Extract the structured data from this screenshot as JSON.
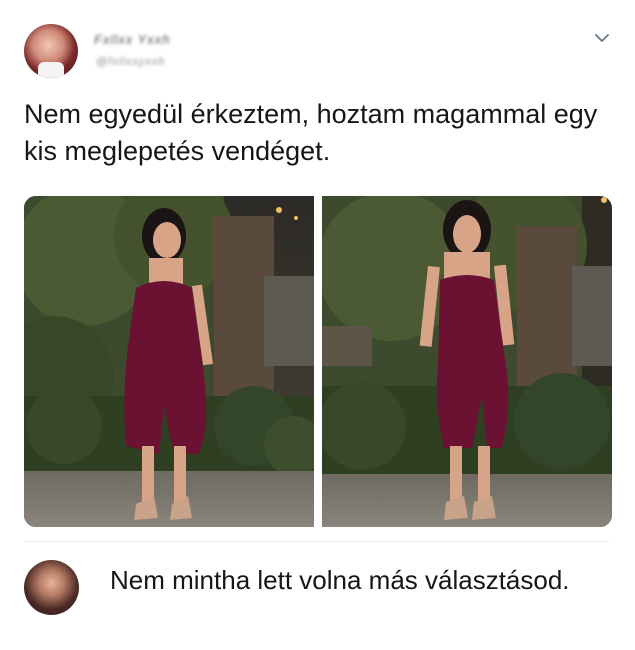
{
  "tweet": {
    "author_name": "Fxllxx Yxxh",
    "author_handle": "@fxllxxyxxh",
    "text": "Nem egyedül érkeztem, hoztam magammal egy kis meglepetés vendéget."
  },
  "reply": {
    "text": "Nem mintha lett volna más választásod."
  },
  "colors": {
    "text": "#14171a",
    "dress": "#6b1233",
    "divider": "#e6ecf0",
    "chevron": "#657786"
  },
  "icons": {
    "menu": "chevron-down-icon"
  }
}
